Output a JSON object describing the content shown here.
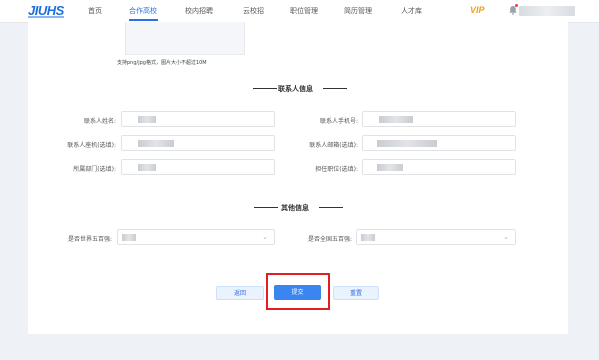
{
  "header": {
    "logo": "JIUHS",
    "nav": [
      {
        "label": "首页",
        "active": false
      },
      {
        "label": "合作高校",
        "active": true
      },
      {
        "label": "校内招聘",
        "active": false
      },
      {
        "label": "云校招",
        "active": false
      },
      {
        "label": "职位管理",
        "active": false
      },
      {
        "label": "简历管理",
        "active": false
      },
      {
        "label": "人才库",
        "active": false
      }
    ],
    "vip": "VIP",
    "accent_color": "#2e6ee6"
  },
  "upload": {
    "tip": "支持png/jpg格式，图片大小不超过10M"
  },
  "contact_section": {
    "title": "联系人信息",
    "fields": {
      "name": {
        "label": "联系人姓名:"
      },
      "phone": {
        "label": "联系人手机号:"
      },
      "landline": {
        "label": "联系人座机(选填):"
      },
      "email": {
        "label": "联系人邮箱(选填):"
      },
      "department": {
        "label": "所属部门(选填):"
      },
      "position": {
        "label": "担任职位(选填):"
      }
    }
  },
  "other_section": {
    "title": "其他信息",
    "fields": {
      "world500": {
        "label": "是否世界五百强:"
      },
      "china500": {
        "label": "是否全国五百强:"
      }
    }
  },
  "actions": {
    "back": "返回",
    "submit": "提交",
    "reset": "重置"
  }
}
